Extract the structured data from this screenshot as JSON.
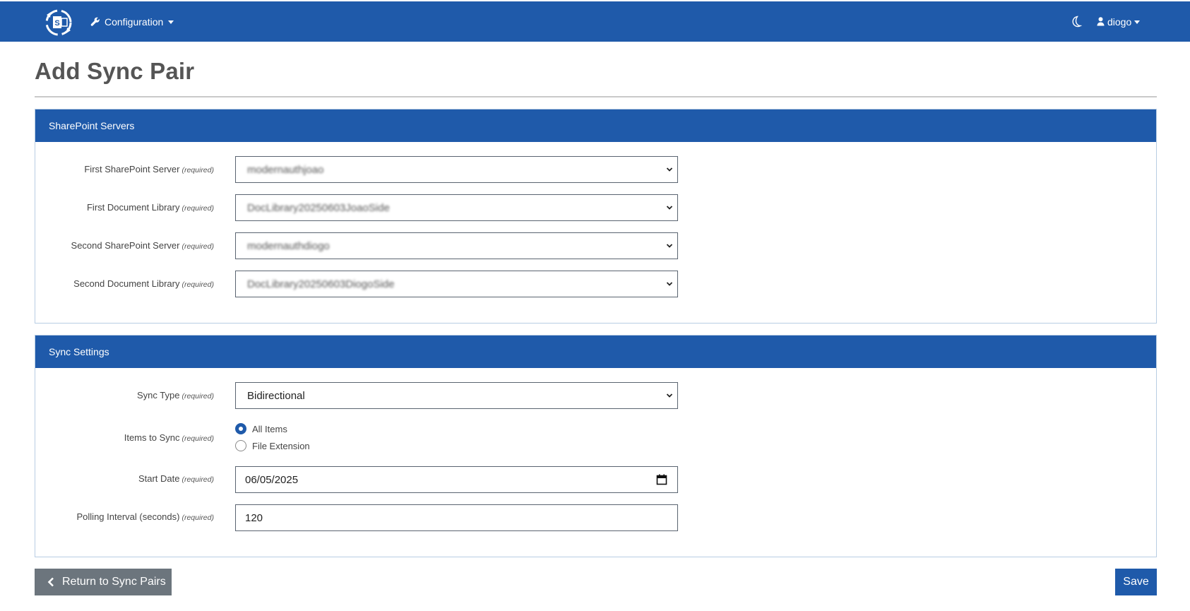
{
  "navbar": {
    "logo_icon": "sharepoint-sync-logo-icon",
    "config_label": "Configuration",
    "config_icon": "wrench-icon",
    "theme_icon": "moon-icon",
    "user_icon": "user-icon",
    "user_label": "diogo",
    "color": "#1f5aaa"
  },
  "page": {
    "title": "Add Sync Pair"
  },
  "sharepoint_servers": {
    "heading": "SharePoint Servers",
    "fields": [
      {
        "label": "First SharePoint Server",
        "required": "(required)",
        "value": "modernauthjoao"
      },
      {
        "label": "First Document Library",
        "required": "(required)",
        "value": "DocLibrary20250603JoaoSide"
      },
      {
        "label": "Second SharePoint Server",
        "required": "(required)",
        "value": "modernauthdiogo"
      },
      {
        "label": "Second Document Library",
        "required": "(required)",
        "value": "DocLibrary20250603DiogoSide"
      }
    ]
  },
  "sync_settings": {
    "heading": "Sync Settings",
    "sync_type": {
      "label": "Sync Type",
      "required": "(required)",
      "value": "Bidirectional"
    },
    "items_to_sync": {
      "label": "Items to Sync",
      "required": "(required)",
      "options": [
        {
          "label": "All Items",
          "checked": true
        },
        {
          "label": "File Extension",
          "checked": false
        }
      ]
    },
    "start_date": {
      "label": "Start Date",
      "required": "(required)",
      "value": "06/05/2025"
    },
    "polling_interval": {
      "label": "Polling Interval (seconds)",
      "required": "(required)",
      "value": "120"
    }
  },
  "buttons": {
    "return_label": "Return to Sync Pairs",
    "return_icon": "chevron-left-icon",
    "save_label": "Save",
    "return_color": "#6c757d",
    "save_color": "#1f5aaa"
  }
}
